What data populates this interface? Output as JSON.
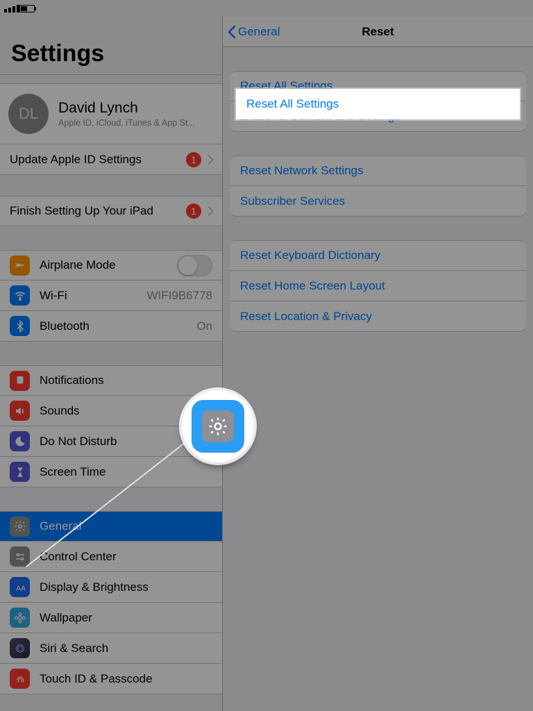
{
  "statusbar": {
    "time_placeholder": "",
    "battery_pct": ""
  },
  "left": {
    "title": "Settings",
    "profile": {
      "initials": "DL",
      "name": "David Lynch",
      "sub": "Apple ID, iCloud, iTunes & App St..."
    },
    "update_row": {
      "label": "Update Apple ID Settings",
      "badge": "1"
    },
    "finish_row": {
      "label": "Finish Setting Up Your iPad",
      "badge": "1"
    },
    "net": {
      "airplane": "Airplane Mode",
      "wifi": "Wi-Fi",
      "wifi_value": "WIFI9B6778",
      "bluetooth": "Bluetooth",
      "bluetooth_value": "On"
    },
    "section1": {
      "notifications": "Notifications",
      "sounds": "Sounds",
      "dnd": "Do Not Disturb",
      "screentime": "Screen Time"
    },
    "section2": {
      "general": "General",
      "controlcenter": "Control Center",
      "display": "Display & Brightness",
      "wallpaper": "Wallpaper",
      "siri": "Siri & Search",
      "touchid": "Touch ID & Passcode"
    }
  },
  "right": {
    "back": "General",
    "title": "Reset",
    "group1": {
      "reset_all": "Reset All Settings",
      "erase_all": "Erase All Content and Settings"
    },
    "group2": {
      "reset_network": "Reset Network Settings",
      "subscriber": "Subscriber Services"
    },
    "group3": {
      "keyboard": "Reset Keyboard Dictionary",
      "homescreen": "Reset Home Screen Layout",
      "location": "Reset Location & Privacy"
    }
  },
  "highlight": {
    "reset_all": "Reset All Settings"
  }
}
